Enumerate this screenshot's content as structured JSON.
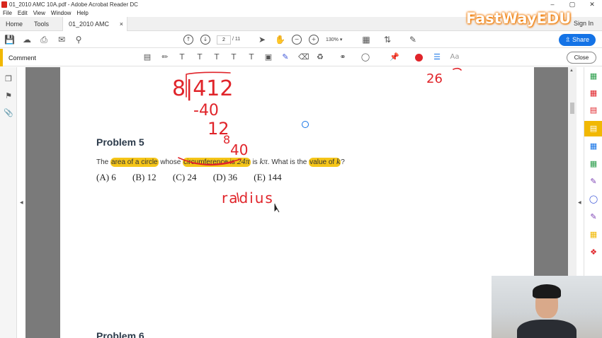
{
  "window": {
    "title": "01_2010 AMC 10A.pdf - Adobe Acrobat Reader DC",
    "controls": [
      "–",
      "▢",
      "✕"
    ]
  },
  "menu": [
    "File",
    "Edit",
    "View",
    "Window",
    "Help"
  ],
  "tabs": {
    "home": "Home",
    "tools": "Tools",
    "document": "01_2010 AMC 10A...",
    "close": "×"
  },
  "account": {
    "sign_in": "Sign In"
  },
  "watermark": "FastWayEDU",
  "toolbar": {
    "page_current": "2",
    "page_total": "/ 11",
    "zoom": "130%",
    "share_label": "Share"
  },
  "comment_bar": {
    "label": "Comment",
    "close_label": "Close",
    "text_tool_glyph": "Aa",
    "active_color": "#e0242a"
  },
  "document": {
    "problem_title": "Problem 5",
    "problem_text": {
      "part1": "The ",
      "hl1": "area of a circle",
      "part2": " whose ",
      "hl2a": "circumference is ",
      "math1": "24π",
      "part3": " is ",
      "math2": "kπ",
      "part4": ". What is the ",
      "hl3": "value of ",
      "math3": "k",
      "part5": "?"
    },
    "choices": [
      "(A) 6",
      "(B) 12",
      "(C) 24",
      "(D) 36",
      "(E) 144"
    ],
    "next_problem_title": "Problem 6",
    "handwriting": {
      "division": "8|412",
      "sub1": "-40",
      "rem1": "12",
      "sub2": "8",
      "rem2": "40",
      "note": "radius",
      "top_right": "26"
    }
  },
  "colors": {
    "highlight": "#f5c518",
    "ink": "#e0242a",
    "accent_blue": "#1473e6",
    "comment_accent": "#f1b803"
  }
}
